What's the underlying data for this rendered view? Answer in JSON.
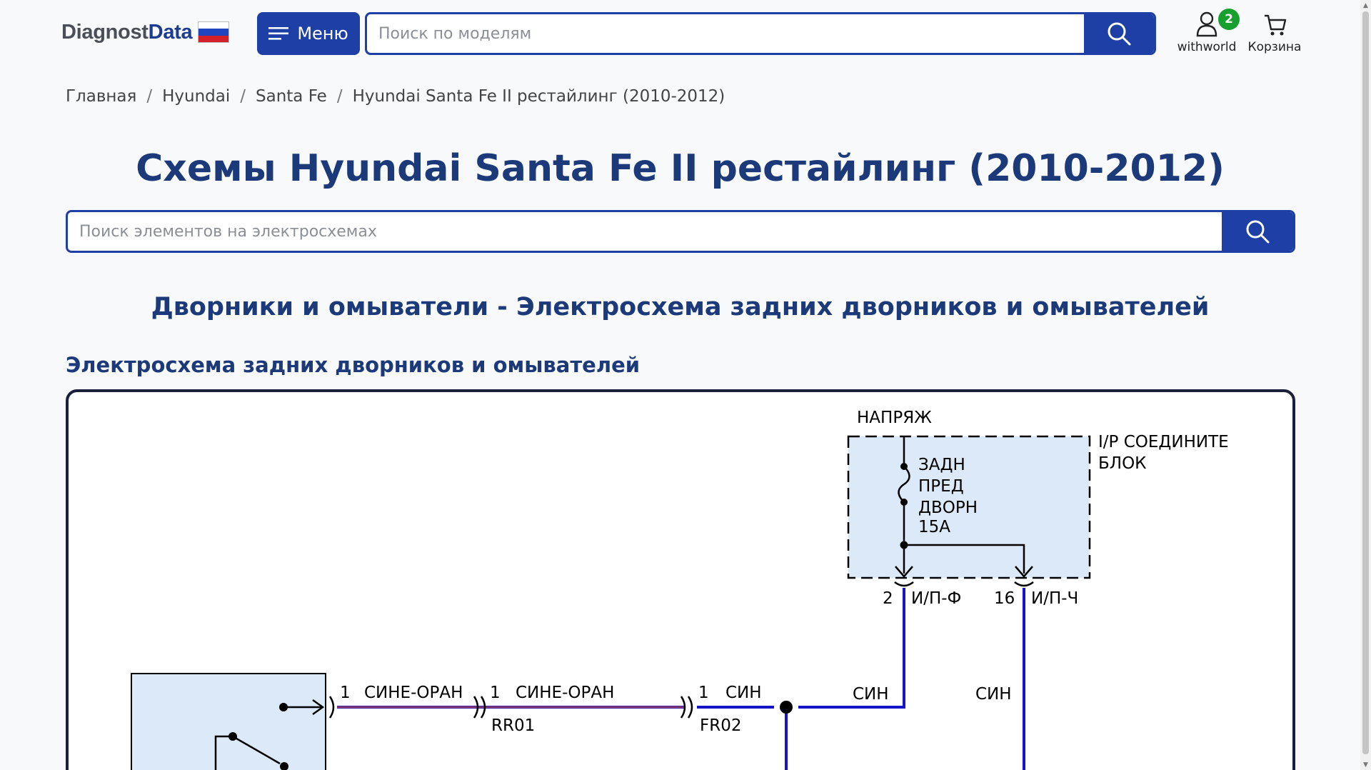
{
  "header": {
    "logo_part1": "Diagnost",
    "logo_part2": "Data",
    "menu_label": "Меню",
    "model_search_placeholder": "Поиск по моделям",
    "user_label": "withworld",
    "user_badge": "2",
    "cart_label": "Корзина"
  },
  "breadcrumb": {
    "items": [
      "Главная",
      "Hyundai",
      "Santa Fe",
      "Hyundai Santa Fe II рестайлинг (2010-2012)"
    ],
    "separator": "/"
  },
  "page_title": "Схемы Hyundai Santa Fe II рестайлинг (2010-2012)",
  "element_search_placeholder": "Поиск элементов на электросхемах",
  "section_title": "Дворники и омыватели - Электросхема задних дворников и омывателей",
  "diagram_title": "Электросхема задних дворников и омывателей",
  "diagram": {
    "power_label": "НАПРЯЖ",
    "block_label_1": "I/P СОЕДИНИТЕ",
    "block_label_2": "БЛОК",
    "fuse_1": "ЗАДН",
    "fuse_2": "ПРЕД",
    "fuse_3": "ДВОРН",
    "fuse_4": "15A",
    "pin_a_num": "2",
    "pin_a_name": "И/П-Ф",
    "pin_b_num": "16",
    "pin_b_name": "И/П-Ч",
    "wire_1_pin": "1",
    "wire_1_color": "СИНЕ-ОРАН",
    "wire_2_pin": "1",
    "wire_2_color": "СИНЕ-ОРАН",
    "conn_1": "RR01",
    "wire_3_pin": "1",
    "wire_3_color": "СИН",
    "conn_2": "FR02",
    "wire_4_color": "СИН",
    "wire_5_color": "СИН"
  },
  "colors": {
    "brand_blue": "#1d3fa6",
    "title_blue": "#1c3a7a",
    "badge_green": "#17a02d",
    "wire_blue": "#1515c8",
    "component_fill": "#dce9f8"
  },
  "icons": [
    "menu-icon",
    "search-icon",
    "user-icon",
    "cart-icon",
    "russia-flag-icon"
  ]
}
